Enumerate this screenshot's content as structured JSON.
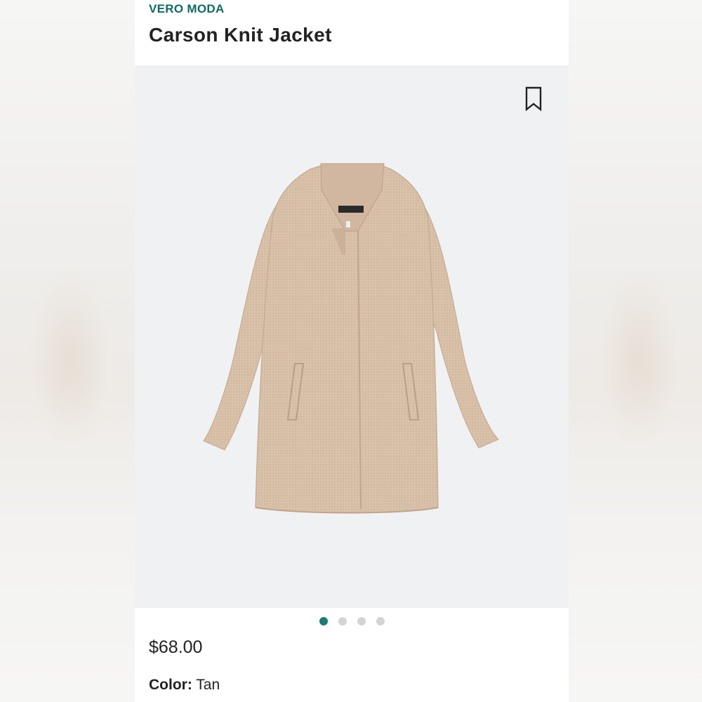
{
  "product": {
    "brand": "VERO MODA",
    "name": "Carson Knit Jacket",
    "price": "$68.00",
    "color_label": "Color:",
    "color_value": "Tan"
  },
  "gallery": {
    "image_count": 4,
    "active_index": 0,
    "image_subject": "tan knit jacket"
  },
  "icons": {
    "bookmark": "bookmark-icon"
  },
  "colors": {
    "brand_accent": "#0e6b63",
    "active_dot": "#1a7c78",
    "inactive_dot": "#d4d4d4",
    "hero_background": "#f0f1f2",
    "jacket_tan": "#d7bea6"
  }
}
